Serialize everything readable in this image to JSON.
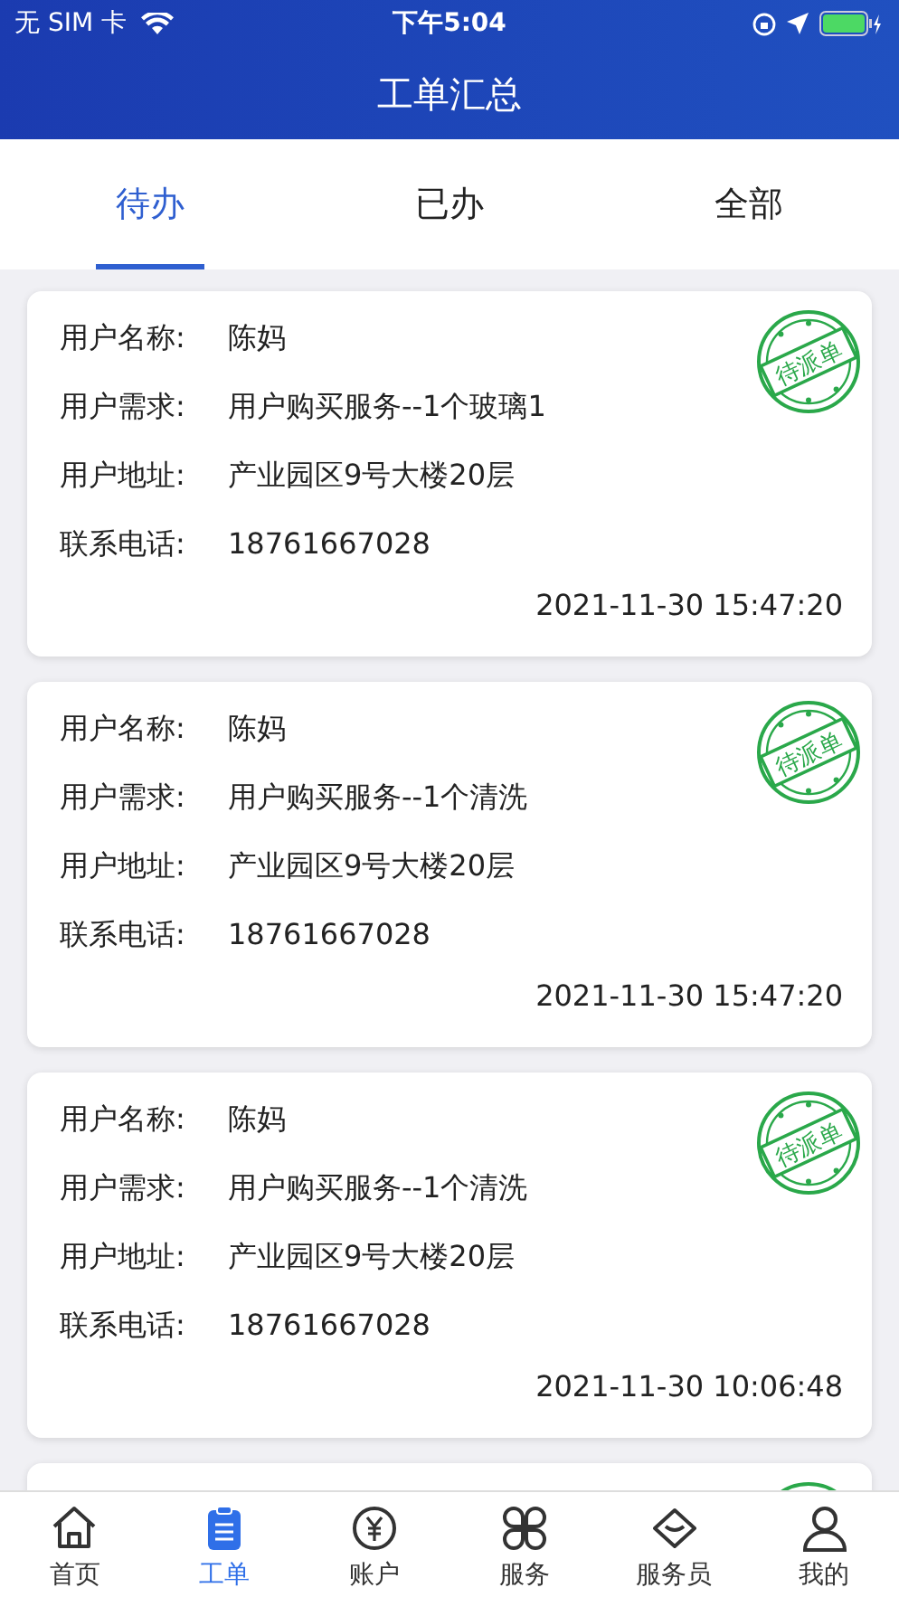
{
  "status_bar": {
    "carrier": "无 SIM 卡",
    "time": "下午5:04"
  },
  "header": {
    "title": "工单汇总"
  },
  "tabs": [
    {
      "label": "待办",
      "selected": true
    },
    {
      "label": "已办",
      "selected": false
    },
    {
      "label": "全部",
      "selected": false
    }
  ],
  "orders": [
    {
      "kind": "card",
      "fields": [
        {
          "label": "用户名称:",
          "value": "陈妈"
        },
        {
          "label": "用户需求:",
          "value": "用户购买服务--1个玻璃1"
        },
        {
          "label": "用户地址:",
          "value": "产业园区9号大楼20层"
        },
        {
          "label": "联系电话:",
          "value": "18761667028"
        }
      ],
      "stamp": "待派单",
      "time": "2021-11-30 15:47:20"
    },
    {
      "kind": "card",
      "fields": [
        {
          "label": "用户名称:",
          "value": "陈妈"
        },
        {
          "label": "用户需求:",
          "value": "用户购买服务--1个清洗"
        },
        {
          "label": "用户地址:",
          "value": "产业园区9号大楼20层"
        },
        {
          "label": "联系电话:",
          "value": "18761667028"
        }
      ],
      "stamp": "待派单",
      "time": "2021-11-30 15:47:20"
    },
    {
      "kind": "card",
      "fields": [
        {
          "label": "用户名称:",
          "value": "陈妈"
        },
        {
          "label": "用户需求:",
          "value": "用户购买服务--1个清洗"
        },
        {
          "label": "用户地址:",
          "value": "产业园区9号大楼20层"
        },
        {
          "label": "联系电话:",
          "value": "18761667028"
        }
      ],
      "stamp": "待派单",
      "time": "2021-11-30 10:06:48"
    },
    {
      "kind": "partial"
    }
  ],
  "tab_bar": [
    {
      "kind": "home",
      "label": "首页",
      "selected": false
    },
    {
      "kind": "clipboard",
      "label": "工单",
      "selected": true
    },
    {
      "kind": "yen",
      "label": "账户",
      "selected": false
    },
    {
      "kind": "clover",
      "label": "服务",
      "selected": false
    },
    {
      "kind": "diamond",
      "label": "服务员",
      "selected": false
    },
    {
      "kind": "person",
      "label": "我的",
      "selected": false
    }
  ]
}
